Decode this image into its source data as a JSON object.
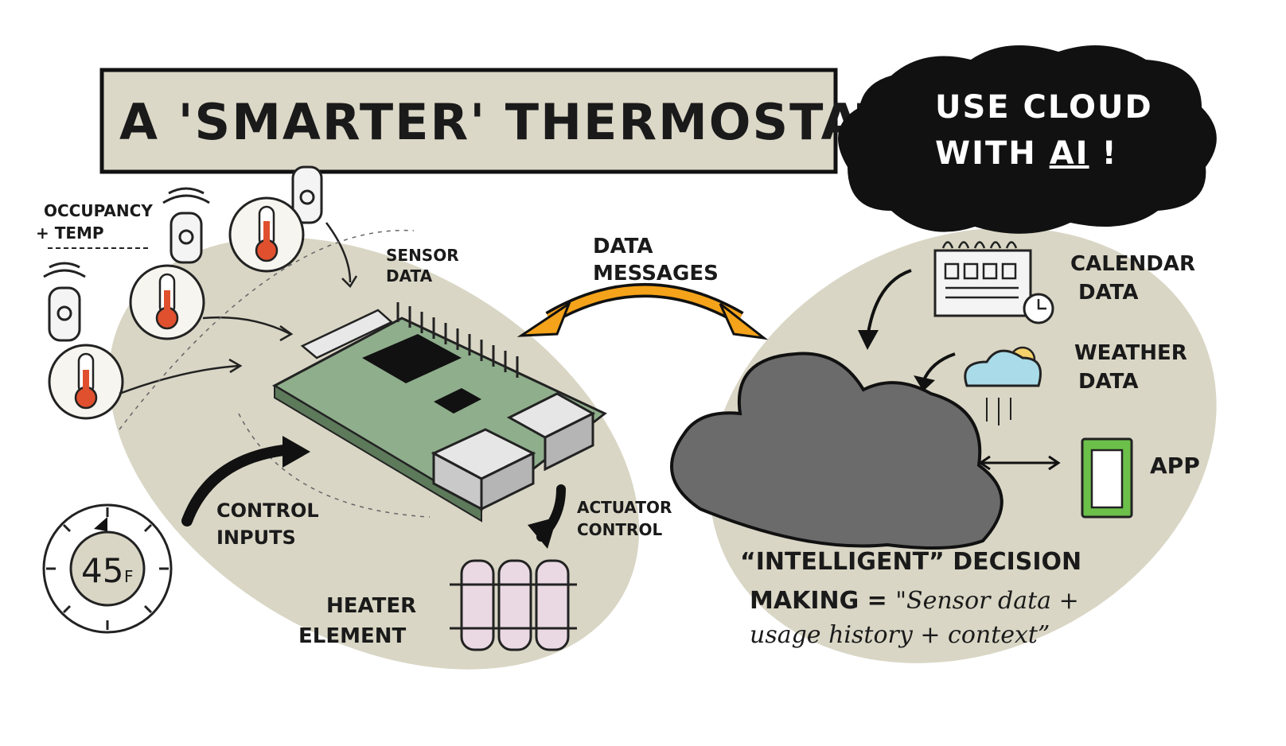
{
  "title": "A 'SMARTER' THERMOSTAT",
  "cloud_callout": {
    "line1": "USE CLOUD",
    "line2_prefix": "WITH ",
    "line2_ai": "AI",
    "line2_suffix": " !"
  },
  "labels": {
    "occupancy_line1": "OCCUPANCY",
    "occupancy_line2": "+ TEMP",
    "sensor_data_line1": "SENSOR",
    "sensor_data_line2": "DATA",
    "data_messages_line1": "DATA",
    "data_messages_line2": "MESSAGES",
    "control_inputs_line1": "CONTROL",
    "control_inputs_line2": "INPUTS",
    "actuator_line1": "ACTUATOR",
    "actuator_line2": "CONTROL",
    "heater_line1": "HEATER",
    "heater_line2": "ELEMENT",
    "calendar_line1": "CALENDAR",
    "calendar_line2": "DATA",
    "weather_line1": "WEATHER",
    "weather_line2": "DATA",
    "app": "APP",
    "dial_value": "45",
    "dial_unit": "F"
  },
  "decision": {
    "line1": "“INTELLIGENT” DECISION",
    "line2_caps": "MAKING = ",
    "line2_script": "\"Sensor data +",
    "line3": "usage history + context”"
  },
  "colors": {
    "blob": "#d9d6c5",
    "title_box": "#dcd8c8",
    "board": "#8fae8c",
    "arrow_orange": "#f5a31a",
    "cloud_grey": "#6b6b6b",
    "thermo_red": "#e0502e",
    "weather_blue": "#a9dbe8",
    "app_green": "#6cc04a",
    "heater_pink": "#ead9e3"
  },
  "icons": [
    "thermometer-icon",
    "occupancy-sensor-icon",
    "raspberry-pi-board",
    "heater-icon",
    "dial-icon",
    "calendar-icon",
    "clock-icon",
    "weather-icon",
    "phone-app-icon",
    "cloud-icon"
  ]
}
